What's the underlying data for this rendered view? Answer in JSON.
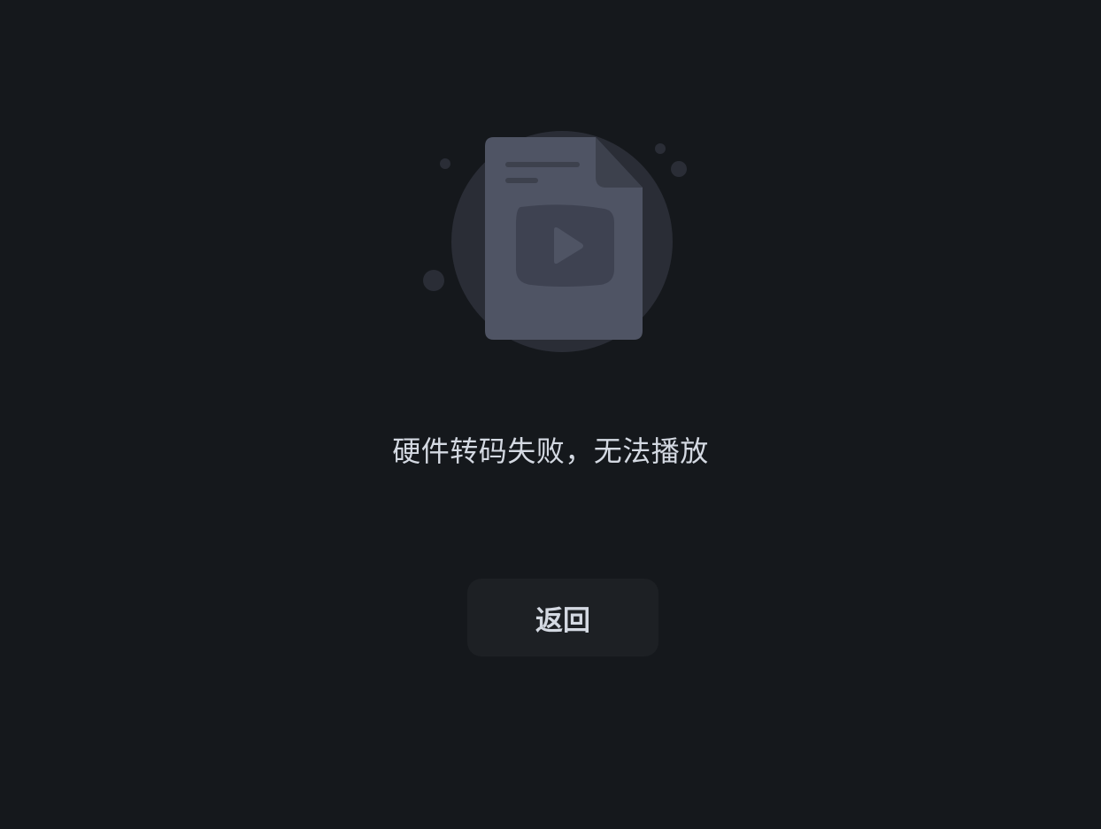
{
  "error": {
    "message": "硬件转码失败，无法播放",
    "illustration_icon": "broken-video-file-icon"
  },
  "actions": {
    "back_label": "返回"
  },
  "colors": {
    "background": "#15181c",
    "text": "#d4d9e2",
    "button_bg": "#1d2024",
    "halo": "#2a2d36",
    "file": "#4f5464",
    "file_fold": "#3d414d",
    "play_box": "#3e4251"
  }
}
